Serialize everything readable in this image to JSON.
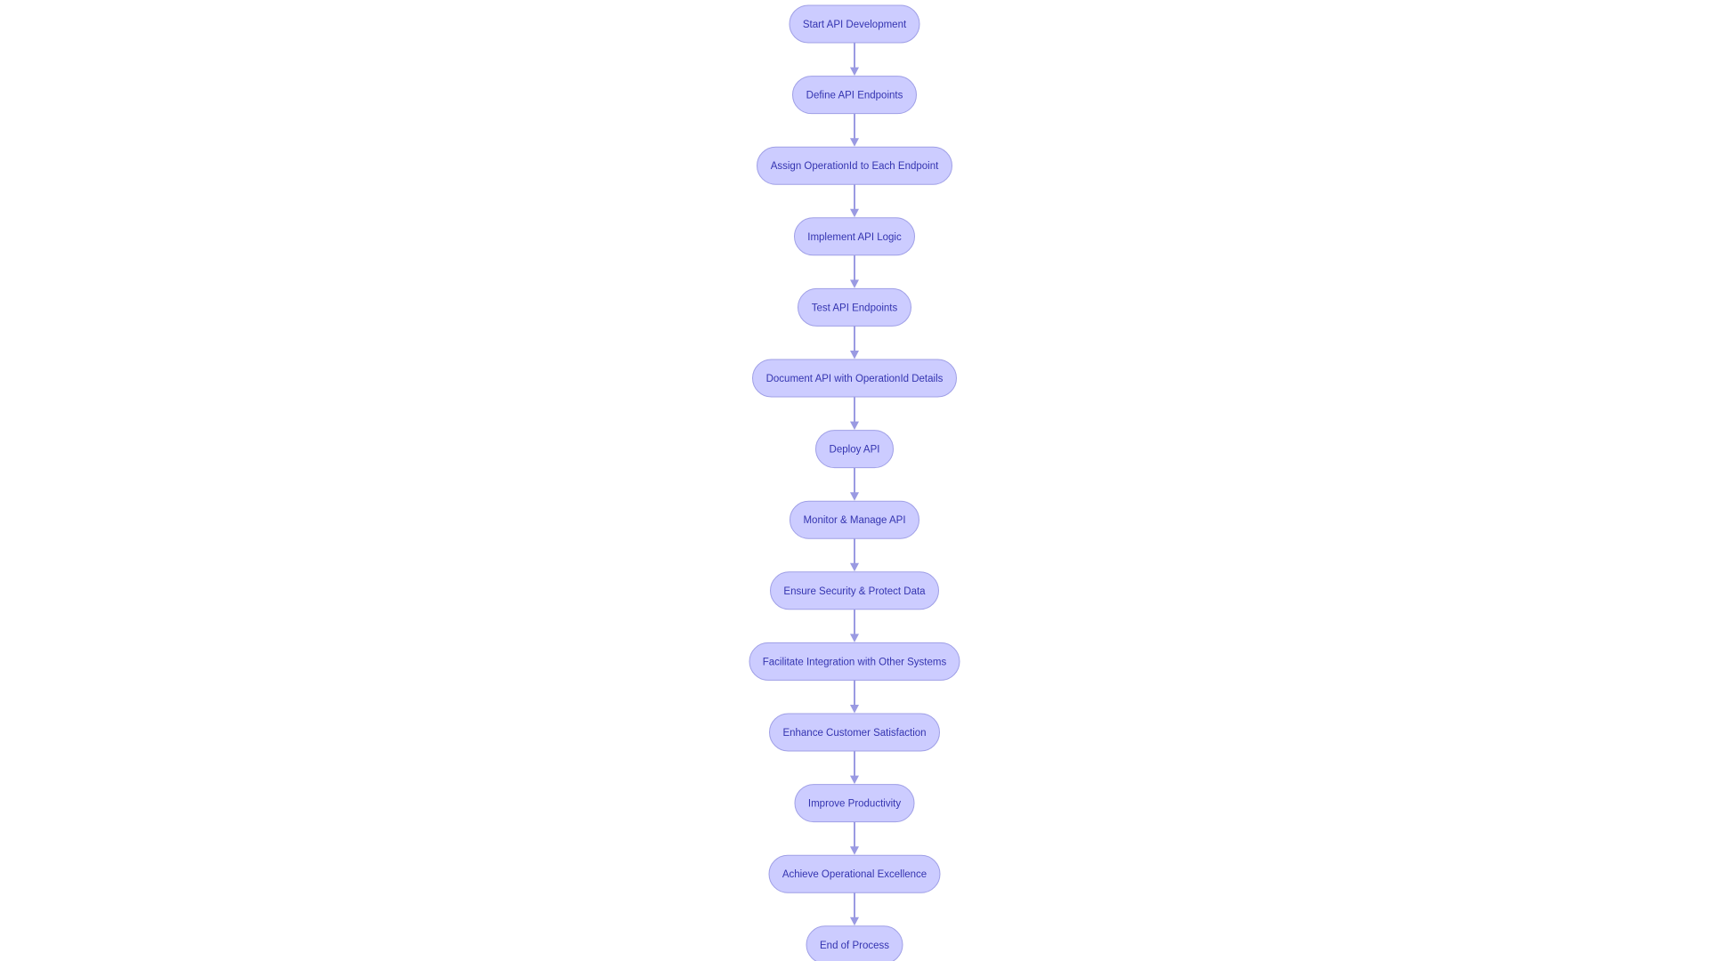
{
  "diagram": {
    "type": "flowchart",
    "direction": "top-to-bottom",
    "colors": {
      "node_fill": "#ccccff",
      "node_stroke": "#9f9fe6",
      "text": "#3434b0",
      "edge": "#9a9ae2",
      "background": "#ffffff"
    },
    "nodes": [
      {
        "id": "n1",
        "label": "Start API Development"
      },
      {
        "id": "n2",
        "label": "Define API Endpoints"
      },
      {
        "id": "n3",
        "label": "Assign OperationId to Each Endpoint"
      },
      {
        "id": "n4",
        "label": "Implement API Logic"
      },
      {
        "id": "n5",
        "label": "Test API Endpoints"
      },
      {
        "id": "n6",
        "label": "Document API with OperationId Details"
      },
      {
        "id": "n7",
        "label": "Deploy API"
      },
      {
        "id": "n8",
        "label": "Monitor & Manage API"
      },
      {
        "id": "n9",
        "label": "Ensure Security & Protect Data"
      },
      {
        "id": "n10",
        "label": "Facilitate Integration with Other Systems"
      },
      {
        "id": "n11",
        "label": "Enhance Customer Satisfaction"
      },
      {
        "id": "n12",
        "label": "Improve Productivity"
      },
      {
        "id": "n13",
        "label": "Achieve Operational Excellence"
      },
      {
        "id": "n14",
        "label": "End of Process"
      }
    ],
    "edges": [
      {
        "from": "n1",
        "to": "n2"
      },
      {
        "from": "n2",
        "to": "n3"
      },
      {
        "from": "n3",
        "to": "n4"
      },
      {
        "from": "n4",
        "to": "n5"
      },
      {
        "from": "n5",
        "to": "n6"
      },
      {
        "from": "n6",
        "to": "n7"
      },
      {
        "from": "n7",
        "to": "n8"
      },
      {
        "from": "n8",
        "to": "n9"
      },
      {
        "from": "n9",
        "to": "n10"
      },
      {
        "from": "n10",
        "to": "n11"
      },
      {
        "from": "n11",
        "to": "n12"
      },
      {
        "from": "n12",
        "to": "n13"
      },
      {
        "from": "n13",
        "to": "n14"
      }
    ]
  }
}
